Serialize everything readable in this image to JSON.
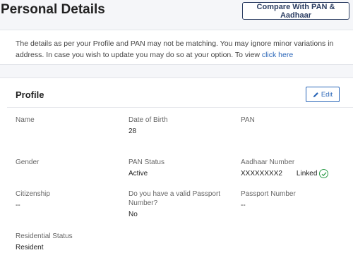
{
  "header": {
    "title": "Personal Details",
    "compare_label": "Compare With PAN & Aadhaar"
  },
  "notice": {
    "text": "The details as per your Profile and PAN may not be matching. You may ignore minor variations in address. In case you wish to update you may do so at your option. To view ",
    "link": "click here"
  },
  "profile": {
    "title": "Profile",
    "edit_label": "Edit",
    "fields": {
      "name": {
        "label": "Name",
        "value": ""
      },
      "dob": {
        "label": "Date of Birth",
        "value": "28"
      },
      "pan": {
        "label": "PAN",
        "value": ""
      },
      "gender": {
        "label": "Gender",
        "value": ""
      },
      "pan_status": {
        "label": "PAN Status",
        "value": "Active"
      },
      "aadhaar": {
        "label": "Aadhaar Number",
        "value": "XXXXXXXX2",
        "linked": "Linked"
      },
      "citizenship": {
        "label": "Citizenship",
        "value": "--"
      },
      "passport_q": {
        "label": "Do you have a valid Passport Number?",
        "value": "No"
      },
      "passport_no": {
        "label": "Passport Number",
        "value": "--"
      },
      "residential": {
        "label": "Residential Status",
        "value": "Resident"
      }
    }
  },
  "colors": {
    "accent": "#2a66b8",
    "navy": "#2c3e63",
    "success": "#2e9d4a"
  },
  "icons": {
    "edit": "pencil-icon",
    "linked": "check-circle-icon"
  }
}
